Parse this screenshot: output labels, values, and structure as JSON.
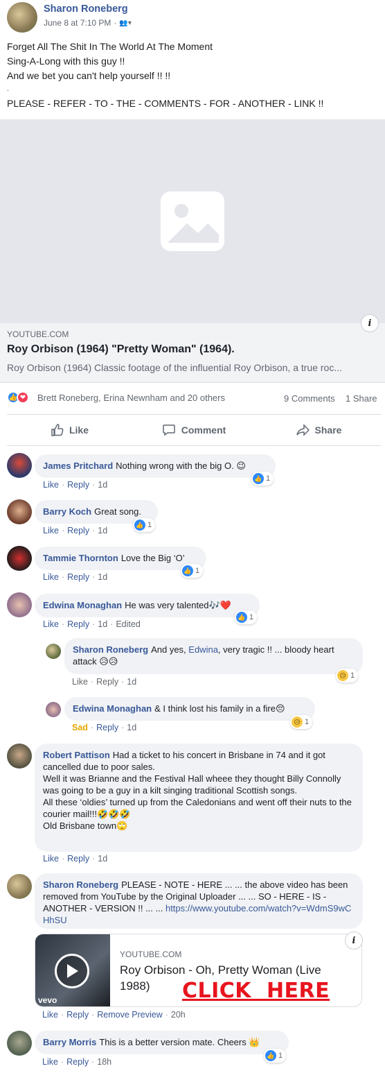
{
  "post": {
    "author": "Sharon Roneberg",
    "timestamp": "June 8 at 7:10 PM",
    "audience_icon": "friends-icon",
    "text_lines": [
      "Forget All The Shit In The World At The Moment",
      "Sing-A-Long with this guy !!",
      "And we bet you can't help yourself !! !!",
      ".",
      "PLEASE - REFER - TO - THE - COMMENTS - FOR - ANOTHER - LINK !!"
    ],
    "link": {
      "domain": "YOUTUBE.COM",
      "title": "Roy Orbison (1964) \"Pretty Woman\" (1964).",
      "description": "Roy Orbison (1964) Classic footage of the influential Roy Orbison, a true roc..."
    },
    "reactions": {
      "names": "Brett Roneberg, Erina Newnham and 20 others",
      "comments": "9 Comments",
      "shares": "1 Share"
    },
    "actions": {
      "like": "Like",
      "comment": "Comment",
      "share": "Share"
    }
  },
  "comments": [
    {
      "name": "James Pritchard",
      "text": "Nothing wrong with the big O. 😉",
      "links": [
        "Like",
        "Reply"
      ],
      "time": "1d",
      "reaction_count": "1"
    },
    {
      "name": "Barry Koch",
      "text": "Great song.",
      "links": [
        "Like",
        "Reply"
      ],
      "time": "1d",
      "reaction_count": "1"
    },
    {
      "name": "Tammie Thornton",
      "text": "Love the Big ‘O’",
      "links": [
        "Like",
        "Reply"
      ],
      "time": "1d",
      "reaction_count": "1"
    },
    {
      "name": "Edwina Monaghan",
      "text": "He was very talented🎶❤️",
      "links": [
        "Like",
        "Reply"
      ],
      "time": "1d",
      "edited": "Edited",
      "reaction_count": "1"
    },
    {
      "name": "Sharon Roneberg",
      "text_pre": "And yes, ",
      "mention": "Edwina",
      "text_post": ", very tragic !! ... bloody heart attack 😥😥",
      "links": [
        "Like",
        "Reply"
      ],
      "time": "1d",
      "reaction_count": "1"
    },
    {
      "name": "Edwina Monaghan",
      "text": "& I think lost his family in a fire😔",
      "links": [
        "Sad",
        "Reply"
      ],
      "time": "1d",
      "reaction_count": "1"
    },
    {
      "name": "Robert Pattison",
      "lines": [
        "Had a ticket to his concert in Brisbane in 74 and it got cancelled due to poor sales.",
        "Well it was Brianne and the Festival Hall wheee they thought Billy Connolly was going to be a guy in a kilt singing traditional Scottish songs.",
        "All these ‘oldies’ turned up from the Caledonians and went off their nuts to the courier mail!!!🤣🤣🤣",
        "Old Brisbane town🙄"
      ],
      "links": [
        "Like",
        "Reply"
      ],
      "time": "1d"
    },
    {
      "name": "Sharon Roneberg",
      "text": "PLEASE - NOTE - HERE ... ... the above video has been removed from YouTube by the Original Uploader ... ... SO - HERE - IS - ANOTHER - VERSION !! ... ... ",
      "url": "https://www.youtube.com/watch?v=WdmS9wCHhSU",
      "preview": {
        "domain": "YOUTUBE.COM",
        "title": "Roy Orbison - Oh, Pretty Woman (Live 1988)",
        "badge": "vevo",
        "overlay": "CLICK  HERE"
      },
      "links": [
        "Like",
        "Reply",
        "Remove Preview"
      ],
      "time": "20h"
    },
    {
      "name": "Barry Morris",
      "text": "This is a better version mate. Cheers 👑",
      "links": [
        "Like",
        "Reply"
      ],
      "time": "18h",
      "reaction_count": "1"
    }
  ],
  "colors": {
    "link": "#385898",
    "like_blue": "#2d88ff",
    "love_red": "#f33e58",
    "sad_yellow": "#f7b125",
    "click_red": "#e8141e"
  }
}
